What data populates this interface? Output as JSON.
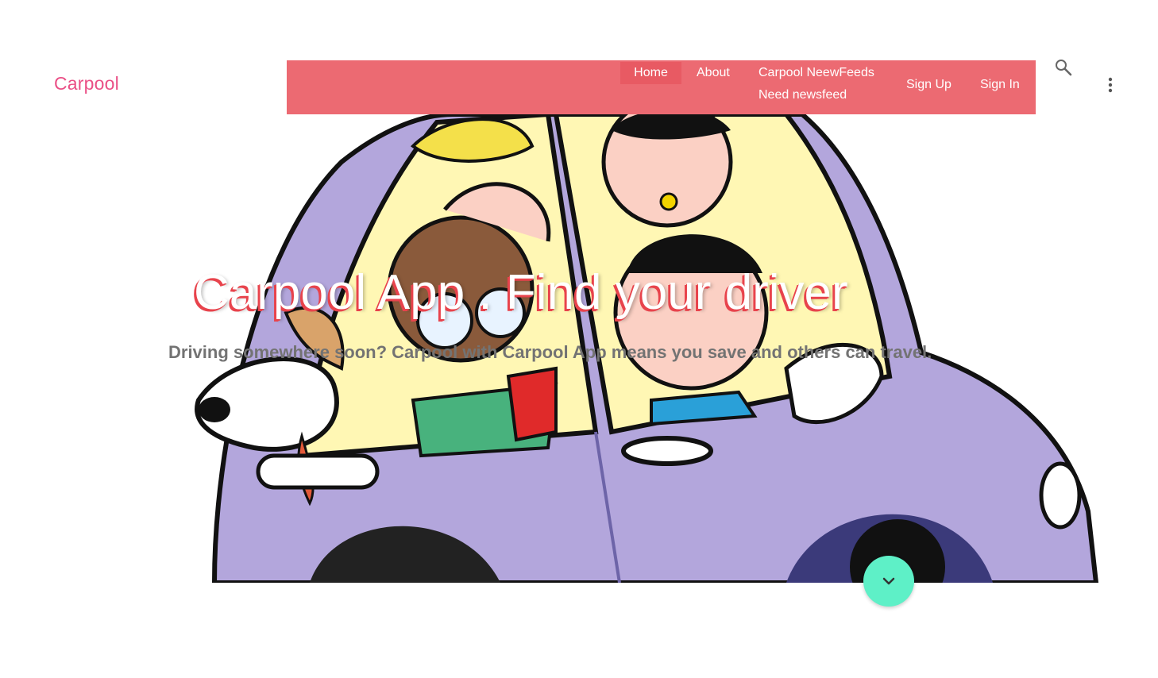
{
  "brand": {
    "name": "Carpool"
  },
  "nav": {
    "home": "Home",
    "about": "About",
    "newsfeeds": "Carpool NeewFeeds",
    "need_newsfeed": "Need newsfeed",
    "sign_up": "Sign Up",
    "sign_in": "Sign In"
  },
  "toolbar": {
    "search_icon": "search-icon",
    "more_icon": "more-vert-icon"
  },
  "hero": {
    "title": "Carpool App . Find your driver",
    "subtitle": "Driving somewhere soon? Carpool with Carpool App means you save and others can travel.",
    "illustration": "cartoon-car-with-passengers-and-dog"
  },
  "scroll_button": {
    "icon": "chevron-down-icon"
  },
  "colors": {
    "brand": "#ea4f86",
    "navbar": "#ec6a72",
    "nav_active": "#e85a63",
    "car_body": "#b3a6dc",
    "window": "#fff7b4",
    "fab": "#5ef0c7",
    "title_shadow": "#e8434c"
  }
}
